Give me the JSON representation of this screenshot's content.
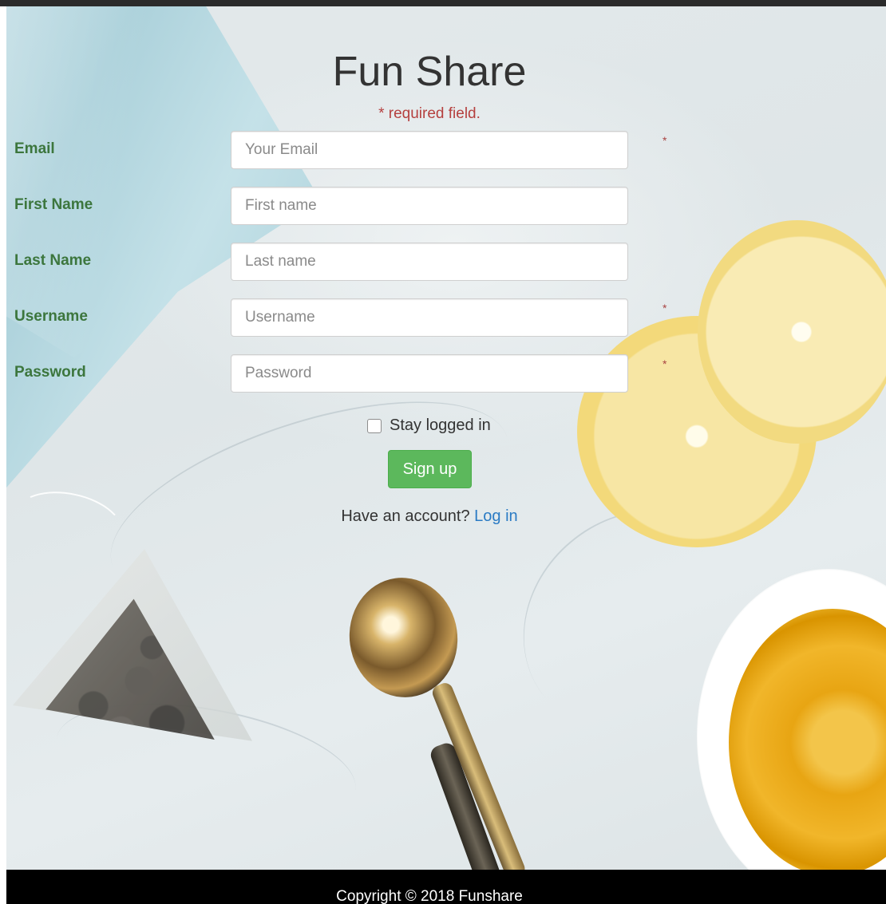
{
  "app": {
    "title": "Fun Share",
    "required_note": "* required field."
  },
  "form": {
    "fields": [
      {
        "label": "Email",
        "placeholder": "Your Email",
        "value": "",
        "required": true,
        "required_mark": "*"
      },
      {
        "label": "First Name",
        "placeholder": "First name",
        "value": "",
        "required": false,
        "required_mark": ""
      },
      {
        "label": "Last Name",
        "placeholder": "Last name",
        "value": "",
        "required": false,
        "required_mark": ""
      },
      {
        "label": "Username",
        "placeholder": "Username",
        "value": "",
        "required": true,
        "required_mark": "*"
      },
      {
        "label": "Password",
        "placeholder": "Password",
        "value": "",
        "required": true,
        "required_mark": "*"
      }
    ],
    "remember_label": "Stay logged in",
    "remember_checked": false,
    "submit_label": "Sign up",
    "account_prompt": "Have an account?",
    "login_link": "Log in"
  },
  "footer": {
    "text": "Copyright © 2018 Funshare"
  },
  "colors": {
    "label_green": "#3c763d",
    "required_red": "#a94442",
    "button_green": "#5cb85c",
    "link_blue": "#2a7bc4",
    "footer_bg": "#000000"
  }
}
